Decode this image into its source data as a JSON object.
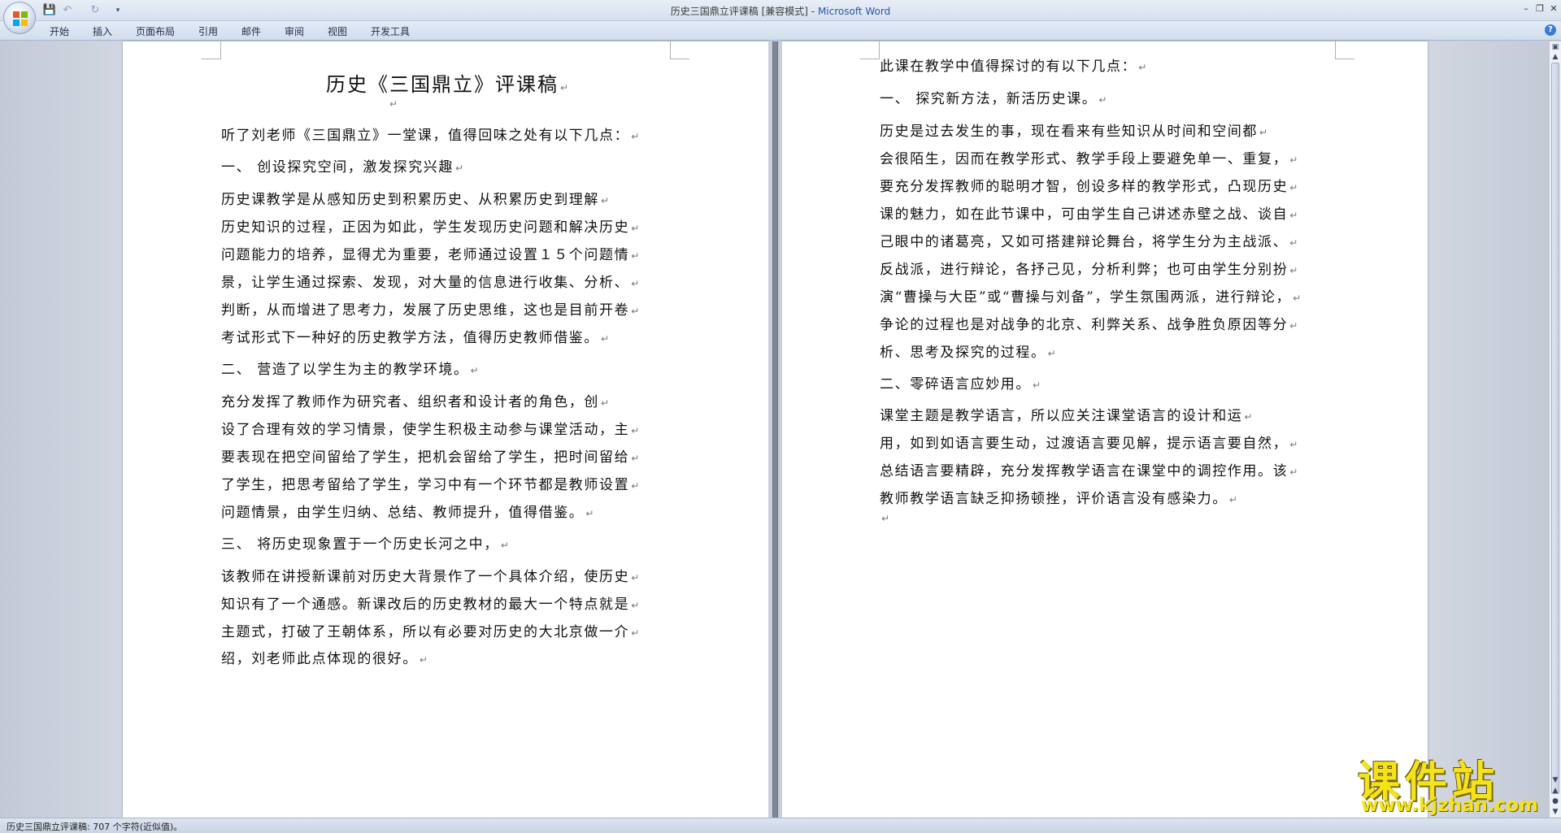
{
  "window": {
    "title_doc": "历史三国鼎立评课稿 [兼容模式]",
    "title_sep": " - ",
    "title_app": "Microsoft Word"
  },
  "quick_access": {
    "icons": [
      "save-icon",
      "undo-icon",
      "redo-icon",
      "customize-icon"
    ]
  },
  "window_controls": [
    "minimize-icon",
    "restore-icon",
    "close-icon"
  ],
  "ribbon": {
    "tabs": [
      "开始",
      "插入",
      "页面布局",
      "引用",
      "邮件",
      "审阅",
      "视图",
      "开发工具"
    ]
  },
  "page1": {
    "title": "历史《三国鼎立》评课稿",
    "lines": [
      "",
      "听了刘老师《三国鼎立》一堂课，值得回味之处有以下几点：",
      "一、  创设探究空间，激发探究兴趣",
      "    历史课教学是从感知历史到积累历史、从积累历史到理解",
      "历史知识的过程，正因为如此，学生发现历史问题和解决历史",
      "问题能力的培养，显得尤为重要，老师通过设置１５个问题情",
      "景，让学生通过探索、发现，对大量的信息进行收集、分析、",
      "判断，从而增进了思考力，发展了历史思维，这也是目前开卷",
      "考试形式下一种好的历史教学方法，值得历史教师借鉴。",
      "二、  营造了以学生为主的教学环境。",
      "    充分发挥了教师作为研究者、组织者和设计者的角色，创",
      "设了合理有效的学习情景，使学生积极主动参与课堂活动，主",
      "要表现在把空间留给了学生，把机会留给了学生，把时间留给",
      "了学生，把思考留给了学生，学习中有一个环节都是教师设置",
      "问题情景，由学生归纳、总结、教师提升，值得借鉴。",
      "三、  将历史现象置于一个历史长河之中，",
      "该教师在讲授新课前对历史大背景作了一个具体介绍，使历史",
      "知识有了一个通感。新课改后的历史教材的最大一个特点就是",
      "主题式，打破了王朝体系，所以有必要对历史的大北京做一介",
      "绍，刘老师此点体现的很好。"
    ]
  },
  "page2": {
    "lines": [
      "此课在教学中值得探讨的有以下几点：",
      "一、  探究新方法，新活历史课。",
      "    历史是过去发生的事，现在看来有些知识从时间和空间都",
      "会很陌生，因而在教学形式、教学手段上要避免单一、重复，",
      "要充分发挥教师的聪明才智，创设多样的教学形式，凸现历史",
      "课的魅力，如在此节课中，可由学生自己讲述赤壁之战、谈自",
      "己眼中的诸葛亮，又如可搭建辩论舞台，将学生分为主战派、",
      "反战派，进行辩论，各抒己见，分析利弊；也可由学生分别扮",
      "演“曹操与大臣”或“曹操与刘备”，学生氛围两派，进行辩论，",
      "争论的过程也是对战争的北京、利弊关系、战争胜负原因等分",
      "析、思考及探究的过程。",
      "二、零碎语言应妙用。",
      "    课堂主题是教学语言，所以应关注课堂语言的设计和运",
      "用，如到如语言要生动，过渡语言要见解，提示语言要自然，",
      "总结语言要精辟，充分发挥教学语言在课堂中的调控作用。该",
      "教师教学语言缺乏抑扬顿挫，评价语言没有感染力。",
      ""
    ]
  },
  "statusbar": {
    "text": "历史三国鼎立评课稿: 707 个字符(近似值)。"
  },
  "watermark": {
    "title": "课件站",
    "url": "www.kjzhan.com"
  }
}
